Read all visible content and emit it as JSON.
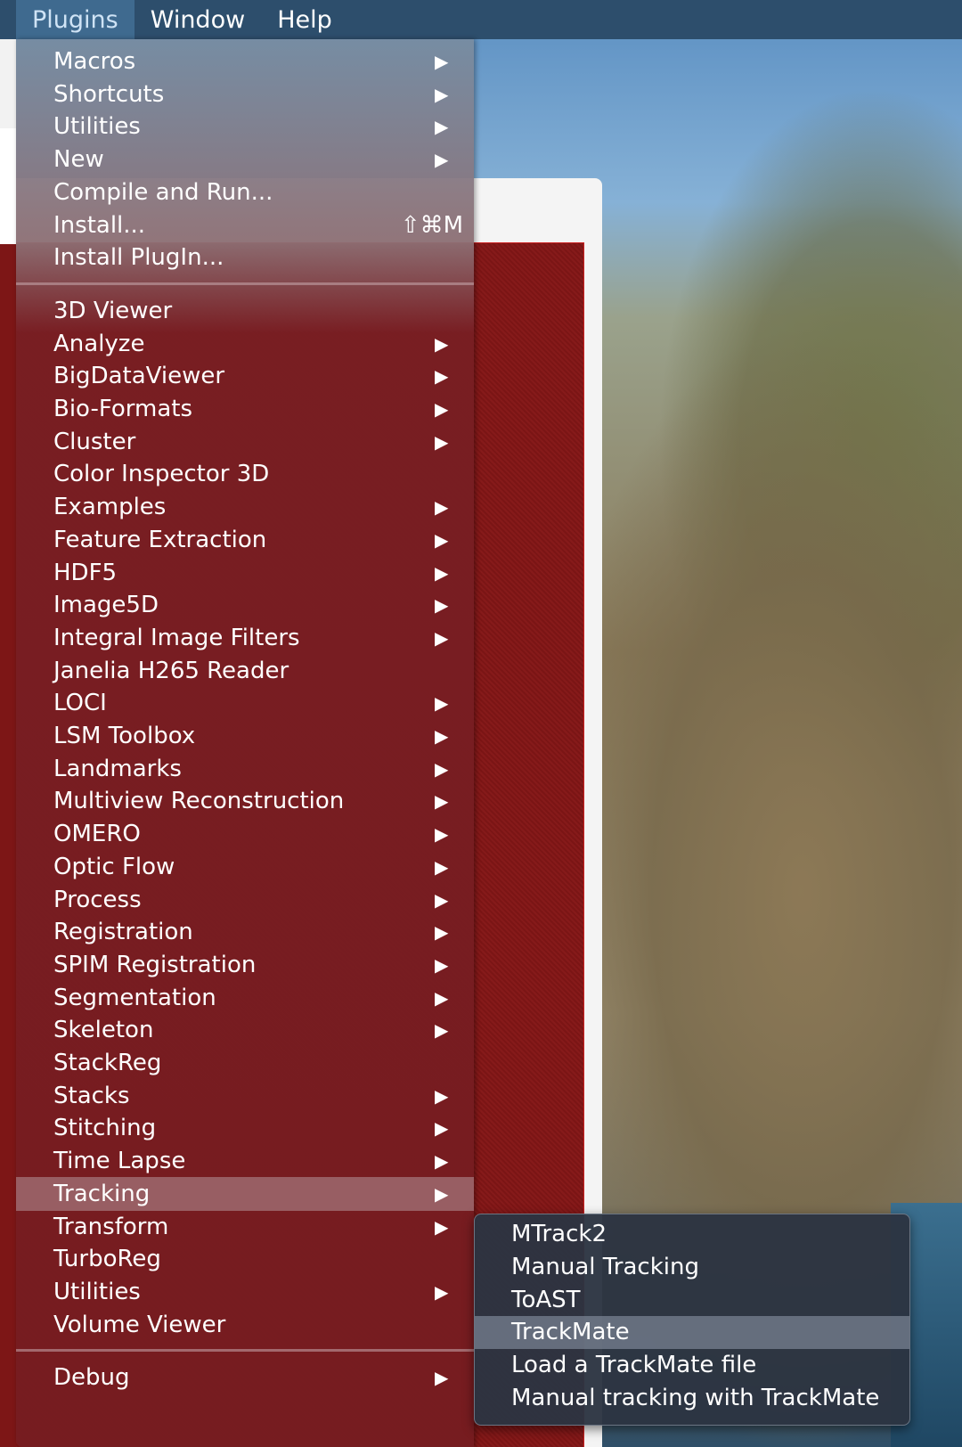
{
  "menubar": {
    "items": [
      "Plugins",
      "Window",
      "Help"
    ]
  },
  "menu": {
    "group1": [
      {
        "label": "Macros",
        "submenu": true,
        "shortcut": ""
      },
      {
        "label": "Shortcuts",
        "submenu": true,
        "shortcut": ""
      },
      {
        "label": "Utilities",
        "submenu": true,
        "shortcut": ""
      },
      {
        "label": "New",
        "submenu": true,
        "shortcut": ""
      },
      {
        "label": "Compile and Run...",
        "submenu": false,
        "shortcut": ""
      },
      {
        "label": "Install...",
        "submenu": false,
        "shortcut": "⇧⌘M"
      },
      {
        "label": "Install PlugIn...",
        "submenu": false,
        "shortcut": ""
      }
    ],
    "group2": [
      {
        "label": "3D Viewer",
        "submenu": false
      },
      {
        "label": "Analyze",
        "submenu": true
      },
      {
        "label": "BigDataViewer",
        "submenu": true
      },
      {
        "label": "Bio-Formats",
        "submenu": true
      },
      {
        "label": "Cluster",
        "submenu": true
      },
      {
        "label": "Color Inspector 3D",
        "submenu": false
      },
      {
        "label": "Examples",
        "submenu": true
      },
      {
        "label": "Feature Extraction",
        "submenu": true
      },
      {
        "label": "HDF5",
        "submenu": true
      },
      {
        "label": "Image5D",
        "submenu": true
      },
      {
        "label": "Integral Image Filters",
        "submenu": true
      },
      {
        "label": "Janelia H265 Reader",
        "submenu": false
      },
      {
        "label": "LOCI",
        "submenu": true
      },
      {
        "label": "LSM Toolbox",
        "submenu": true
      },
      {
        "label": "Landmarks",
        "submenu": true
      },
      {
        "label": "Multiview Reconstruction",
        "submenu": true
      },
      {
        "label": "OMERO",
        "submenu": true
      },
      {
        "label": "Optic Flow",
        "submenu": true
      },
      {
        "label": "Process",
        "submenu": true
      },
      {
        "label": "Registration",
        "submenu": true
      },
      {
        "label": "SPIM Registration",
        "submenu": true
      },
      {
        "label": "Segmentation",
        "submenu": true
      },
      {
        "label": "Skeleton",
        "submenu": true
      },
      {
        "label": "StackReg",
        "submenu": false
      },
      {
        "label": "Stacks",
        "submenu": true
      },
      {
        "label": "Stitching",
        "submenu": true
      },
      {
        "label": "Time Lapse",
        "submenu": true
      },
      {
        "label": "Tracking",
        "submenu": true,
        "highlighted": true
      },
      {
        "label": "Transform",
        "submenu": true
      },
      {
        "label": "TurboReg",
        "submenu": false
      },
      {
        "label": "Utilities",
        "submenu": true
      },
      {
        "label": "Volume Viewer",
        "submenu": false
      }
    ],
    "group3": [
      {
        "label": "Debug",
        "submenu": true
      }
    ],
    "arrow_glyph": "▶"
  },
  "submenu": {
    "items": [
      {
        "label": "MTrack2"
      },
      {
        "label": "Manual Tracking"
      },
      {
        "label": "ToAST"
      },
      {
        "label": "TrackMate",
        "highlighted": true
      },
      {
        "label": "Load a TrackMate file"
      },
      {
        "label": "Manual tracking with TrackMate"
      }
    ]
  },
  "colors": {
    "menubar_bg": "#2d4e6c",
    "menu_red": "#761c20",
    "highlight": "#b4969b",
    "submenu_bg": "#2c3442"
  }
}
